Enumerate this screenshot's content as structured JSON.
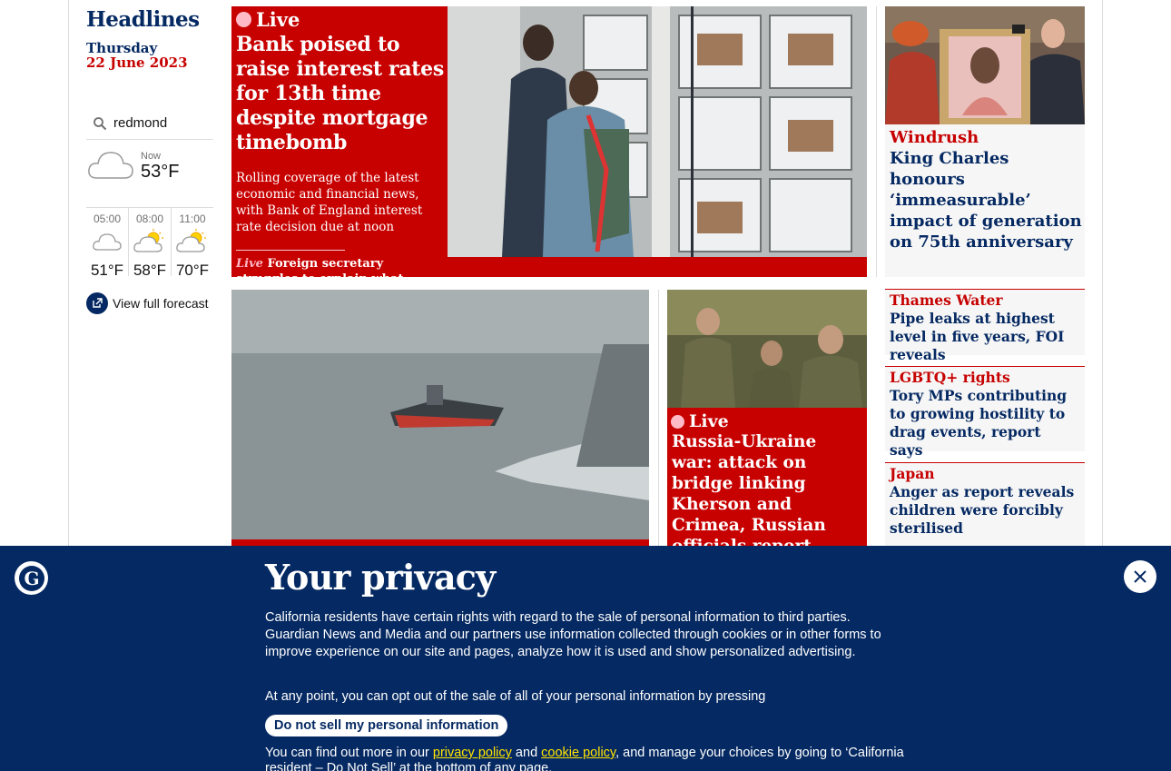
{
  "sidebar": {
    "title": "Headlines",
    "day": "Thursday",
    "date": "22 June 2023",
    "search_value": "redmond",
    "weather_now_label": "Now",
    "weather_now_temp": "53°F",
    "forecast": [
      {
        "time": "05:00",
        "temp": "51°F",
        "icon": "cloud-icon"
      },
      {
        "time": "08:00",
        "temp": "58°F",
        "icon": "sun-cloud-icon"
      },
      {
        "time": "11:00",
        "temp": "70°F",
        "icon": "sun-cloud-icon"
      }
    ],
    "full_forecast_label": "View full forecast"
  },
  "lead": {
    "live_label": "Live",
    "title": "Bank poised to raise interest rates for 13th time despite mortgage timebomb",
    "standfirst": "Rolling coverage of the latest economic and financial news, with Bank of England interest rate decision due at noon",
    "sublink_kicker": "Live",
    "sublink_text": "Foreign secretary struggles to explain what government is doing to reduce inflation"
  },
  "right_top": {
    "kicker": "Windrush",
    "title": "King Charles honours ‘immeasurable’ impact of generation on 75th anniversary"
  },
  "small_stories": [
    {
      "kicker": "Thames Water",
      "title": "Pipe leaks at highest level in five years, FOI reveals"
    },
    {
      "kicker": "LGBTQ+ rights",
      "title": "Tory MPs contributing to growing hostility to drag events, report says"
    },
    {
      "kicker": "Japan",
      "title": "Anger as report reveals children were forcibly sterilised"
    }
  ],
  "ukraine": {
    "live_label": "Live",
    "title": "Russia-Ukraine war: attack on bridge linking Kherson and Crimea, Russian officials report"
  },
  "privacy": {
    "title": "Your privacy",
    "p1": "California residents have certain rights with regard to the sale of personal information to third parties. Guardian News and Media and our partners use information collected through cookies or in other forms to improve experience on our site and pages, analyze how it is used and show personalized advertising.",
    "p2": "At any point, you can opt out of the sale of all of your personal information by pressing",
    "button_label": "Do not sell my personal information",
    "p3_start": "You can find out more in our ",
    "privacy_link": "privacy policy",
    "p3_and": " and ",
    "cookie_link": "cookie policy",
    "p3_end": ", and manage your choices by going to ‘California resident – Do Not Sell’ at the bottom of any page."
  },
  "colors": {
    "brand": "#052962",
    "news_red": "#c70000",
    "live_pink": "#ffbac8",
    "link_yellow": "#ffe500"
  }
}
